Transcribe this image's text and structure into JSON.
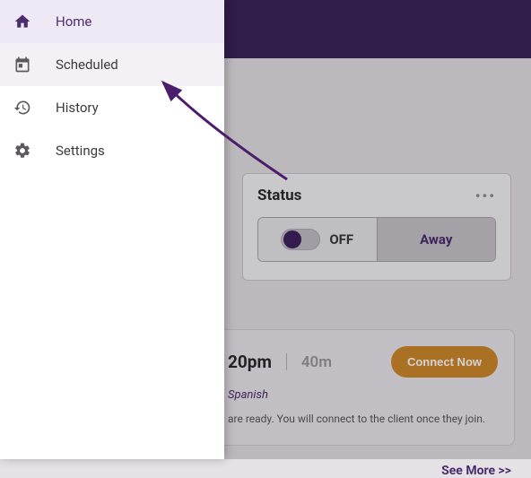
{
  "colors": {
    "brand": "#4b2d6e",
    "banner": "#3c2459",
    "accent": "#d08a2e"
  },
  "sidebar": {
    "items": [
      {
        "label": "Home"
      },
      {
        "label": "Scheduled"
      },
      {
        "label": "History"
      },
      {
        "label": "Settings"
      }
    ]
  },
  "status": {
    "title": "Status",
    "off_label": "OFF",
    "away_label": "Away"
  },
  "appointment": {
    "time": "20pm",
    "duration": "40m",
    "connect_label": "Connect Now",
    "language": "Spanish",
    "message": "are ready. You will connect to the client once they join."
  },
  "see_more_label": "See More >>"
}
